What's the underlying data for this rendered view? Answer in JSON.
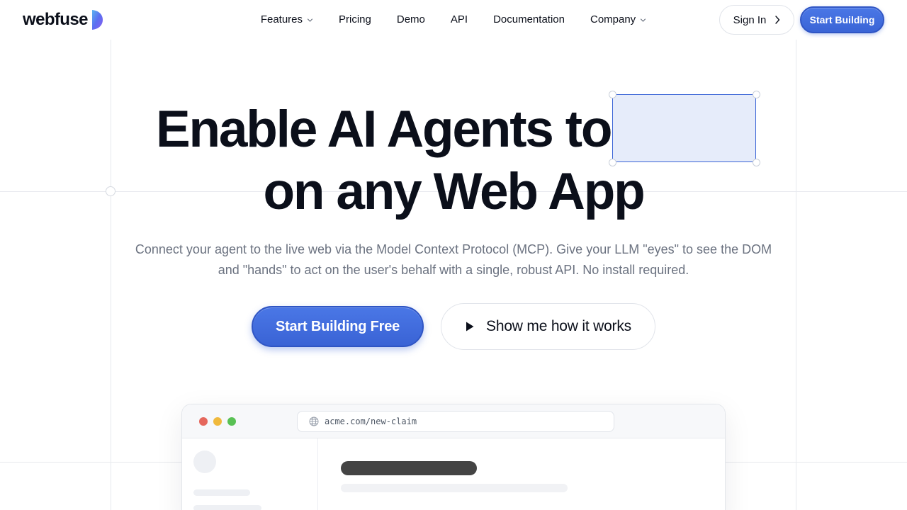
{
  "brand": {
    "name": "webfuse",
    "accent": "#3a64d6"
  },
  "nav": {
    "items": [
      {
        "label": "Features",
        "dropdown": true
      },
      {
        "label": "Pricing",
        "dropdown": false
      },
      {
        "label": "Demo",
        "dropdown": false
      },
      {
        "label": "API",
        "dropdown": false
      },
      {
        "label": "Documentation",
        "dropdown": false
      },
      {
        "label": "Company",
        "dropdown": true
      }
    ],
    "sign_in": "Sign In",
    "start": "Start Building"
  },
  "hero": {
    "line1": "Enable AI Agents to",
    "line2": "on any Web App",
    "subtitle": "Connect your agent to the live web via the Model Context Protocol (MCP). Give your LLM \"eyes\" to see the DOM and \"hands\" to act on the user's behalf with a single, robust API. No install required.",
    "cta_primary": "Start Building Free",
    "cta_secondary": "Show me how it works"
  },
  "browser": {
    "url": "acme.com/new-claim",
    "traffic_lights": [
      "#e5675c",
      "#f0b93c",
      "#59c154"
    ]
  }
}
